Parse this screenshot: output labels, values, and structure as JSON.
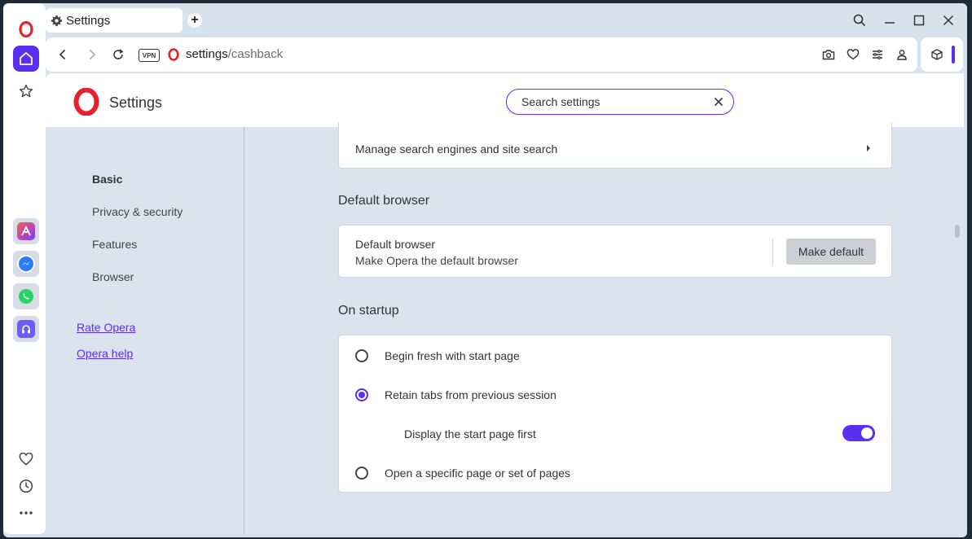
{
  "tab": {
    "title": "Settings"
  },
  "address": {
    "vpn_label": "VPN",
    "url_host": "settings",
    "url_path": "/cashback"
  },
  "header": {
    "title": "Settings",
    "search_value": "Search settings"
  },
  "nav": {
    "items": [
      "Basic",
      "Privacy & security",
      "Features",
      "Browser"
    ],
    "links": [
      "Rate Opera",
      "Opera help"
    ]
  },
  "search_engines": {
    "label": "Manage search engines and site search"
  },
  "default_browser": {
    "section_title": "Default browser",
    "title": "Default browser",
    "subtitle": "Make Opera the default browser",
    "button": "Make default"
  },
  "startup": {
    "section_title": "On startup",
    "options": [
      "Begin fresh with start page",
      "Retain tabs from previous session",
      "Open a specific page or set of pages"
    ],
    "selected_index": 1,
    "sub_option": "Display the start page first",
    "sub_option_enabled": true
  },
  "colors": {
    "accent": "#5a2ff0",
    "opera_red": "#e8212e"
  }
}
